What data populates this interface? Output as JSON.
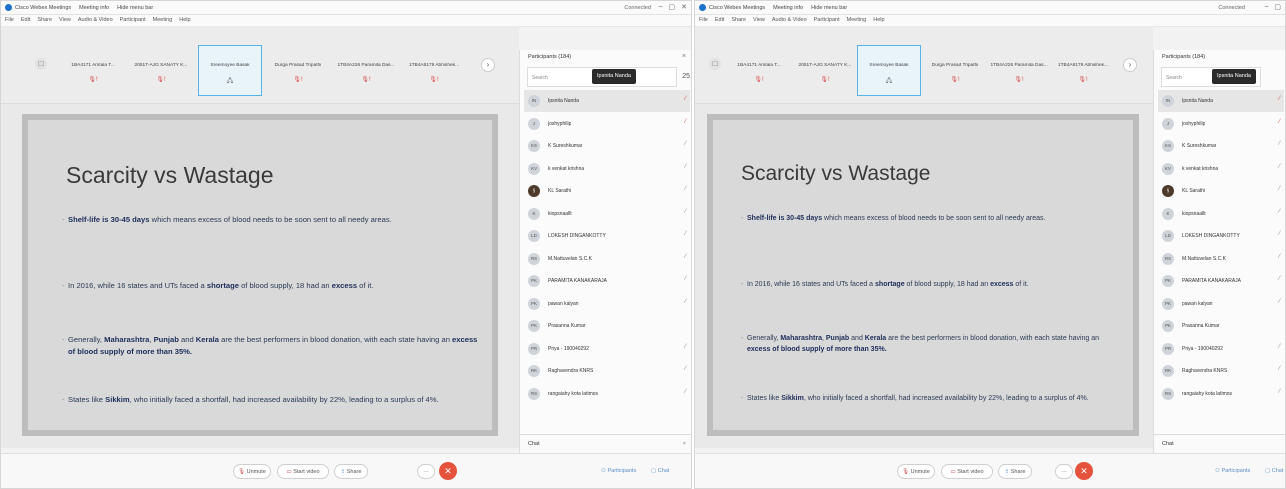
{
  "window": {
    "title_tabs": [
      "Cisco Webex Meetings",
      "Meeting info",
      "Hide menu bar"
    ],
    "connection": "Connected",
    "controls": [
      "–",
      "▢",
      "✕"
    ]
  },
  "menu": [
    "File",
    "Edit",
    "Share",
    "View",
    "Audio & Video",
    "Participant",
    "Meeting",
    "Help"
  ],
  "thumbnails": [
    {
      "name": "1BA4171 Amtala T...",
      "mic": "🎙!"
    },
    {
      "name": "2051T-AJG SANATY K...",
      "mic": "🎙!"
    },
    {
      "name": "Sreemoyee Basak",
      "mic": "🖧",
      "active": true
    },
    {
      "name": "Durga Prasad Tripathi",
      "mic": "🎙!"
    },
    {
      "name": "1TB4A226 Paramita Das...",
      "mic": "🎙!"
    },
    {
      "name": "1TB4A6179 Abhishek...",
      "mic": "🎙!"
    }
  ],
  "slide": {
    "title": "Scarcity vs Wastage",
    "bullets": [
      [
        {
          "t": "Shelf-life is 30-45 days",
          "b": true
        },
        {
          "t": " which means excess of blood needs to be soon sent to all needy areas."
        }
      ],
      [
        {
          "t": "In 2016, while 16 states and UTs faced a "
        },
        {
          "t": "shortage",
          "b": true
        },
        {
          "t": " of blood supply, 18 had an "
        },
        {
          "t": "excess",
          "b": true
        },
        {
          "t": " of it."
        }
      ],
      [
        {
          "t": "Generally, "
        },
        {
          "t": "Maharashtra",
          "b": true
        },
        {
          "t": ", "
        },
        {
          "t": "Punjab",
          "b": true
        },
        {
          "t": " and "
        },
        {
          "t": "Kerala",
          "b": true
        },
        {
          "t": " are the best performers in blood donation, with each state having an "
        },
        {
          "t": "excess of blood supply of more than 35%.",
          "b": true
        }
      ],
      [
        {
          "t": "States like "
        },
        {
          "t": "Sikkim",
          "b": true
        },
        {
          "t": ", who initially faced a shortfall, had increased availability by 22%, leading to a surplus of 4%."
        }
      ]
    ]
  },
  "participants": {
    "header": "Participants (184)",
    "search_placeholder": "Search",
    "count": "25",
    "tooltip": "Ipsnita Nanda",
    "list": [
      {
        "initials": "IN",
        "name": "Ipsnita Nanda",
        "mic": "muted",
        "selected": true
      },
      {
        "initials": "J",
        "name": "joshyphilip",
        "mic": "muted"
      },
      {
        "initials": "KS",
        "name": "K Sureshkumar",
        "mic": "on"
      },
      {
        "initials": "KV",
        "name": "k venkat krishna",
        "mic": "on"
      },
      {
        "initials": "",
        "name": "KL Sarathi",
        "mic": "on",
        "photo": true
      },
      {
        "initials": "K",
        "name": "kiopsnaallt",
        "mic": "on"
      },
      {
        "initials": "LD",
        "name": "LOKESH DINGANKOTTY",
        "mic": "on"
      },
      {
        "initials": "RS",
        "name": "M.Nattuvelan S.C.K",
        "mic": "on"
      },
      {
        "initials": "PK",
        "name": "PARAMITA KANAKARAJA",
        "mic": "on"
      },
      {
        "initials": "PK",
        "name": "pawan kalyan",
        "mic": "on"
      },
      {
        "initials": "PK",
        "name": "Prasanna Kumar",
        "mic": "none"
      },
      {
        "initials": "PR",
        "name": "Priya - 190040292",
        "mic": "on"
      },
      {
        "initials": "RK",
        "name": "Raghavendra KNRS",
        "mic": "on"
      },
      {
        "initials": "RS",
        "name": "rangaiahy kota latimos",
        "mic": "on"
      }
    ]
  },
  "chat_label": "Chat",
  "controls": {
    "unmute": "Unmute",
    "start_video": "Start video",
    "share": "Share",
    "more": "···",
    "end": "✕",
    "participants": "Participants",
    "chat": "Chat"
  }
}
